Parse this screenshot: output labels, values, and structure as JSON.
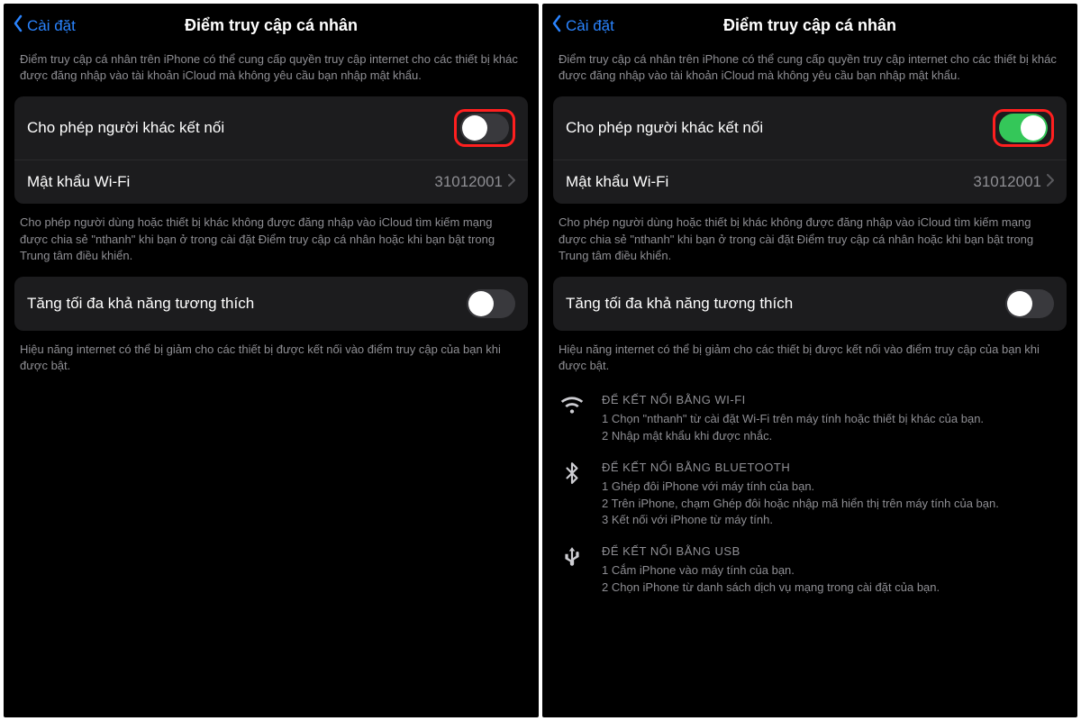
{
  "nav": {
    "back": "Cài đặt",
    "title": "Điểm truy cập cá nhân"
  },
  "intro": "Điểm truy cập cá nhân trên iPhone có thể cung cấp quyền truy cập internet cho các thiết bị khác được đăng nhập vào tài khoản iCloud mà không yêu cầu bạn nhập mật khẩu.",
  "allow": {
    "label": "Cho phép người khác kết nối"
  },
  "wifipw": {
    "label": "Mật khẩu Wi-Fi",
    "value": "31012001"
  },
  "allow_desc": "Cho phép người dùng hoặc thiết bị khác không được đăng nhập vào iCloud tìm kiếm mạng được chia sẻ \"nthanh\" khi bạn ở trong cài đặt Điểm truy cập cá nhân hoặc khi bạn bật trong Trung tâm điều khiển.",
  "compat": {
    "label": "Tăng tối đa khả năng tương thích",
    "desc": "Hiệu năng internet có thể bị giảm cho các thiết bị được kết nối vào điểm truy cập của bạn khi được bật."
  },
  "instructions": {
    "wifi": {
      "title": "ĐỂ KẾT NỐI BẰNG WI-FI",
      "s1": "1 Chọn \"nthanh\" từ cài đặt Wi-Fi trên máy tính hoặc thiết bị khác của bạn.",
      "s2": "2 Nhập mật khẩu khi được nhắc."
    },
    "bt": {
      "title": "ĐỂ KẾT NỐI BẰNG BLUETOOTH",
      "s1": "1 Ghép đôi iPhone với máy tính của bạn.",
      "s2": "2 Trên iPhone, chạm Ghép đôi hoặc nhập mã hiển thị trên máy tính của bạn.",
      "s3": "3 Kết nối với iPhone từ máy tính."
    },
    "usb": {
      "title": "ĐỂ KẾT NỐI BẰNG USB",
      "s1": "1 Cắm iPhone vào máy tính của bạn.",
      "s2": "2 Chọn iPhone từ danh sách dịch vụ mạng trong cài đặt của bạn."
    }
  }
}
